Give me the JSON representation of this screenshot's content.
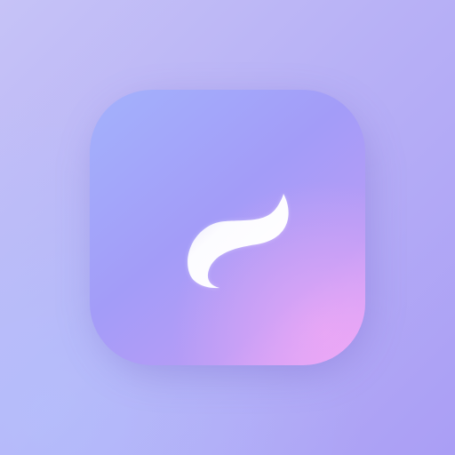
{
  "background": {
    "colors": [
      "#c6c3f7",
      "#b8b1f6",
      "#aa9ef5"
    ]
  },
  "app_icon": {
    "icon_name": "wave-swirl-icon",
    "colors": [
      "#a3b2fc",
      "#a39cf8",
      "#b79cf6",
      "#e9a6f6"
    ],
    "glyph_color": "#ffffff"
  }
}
